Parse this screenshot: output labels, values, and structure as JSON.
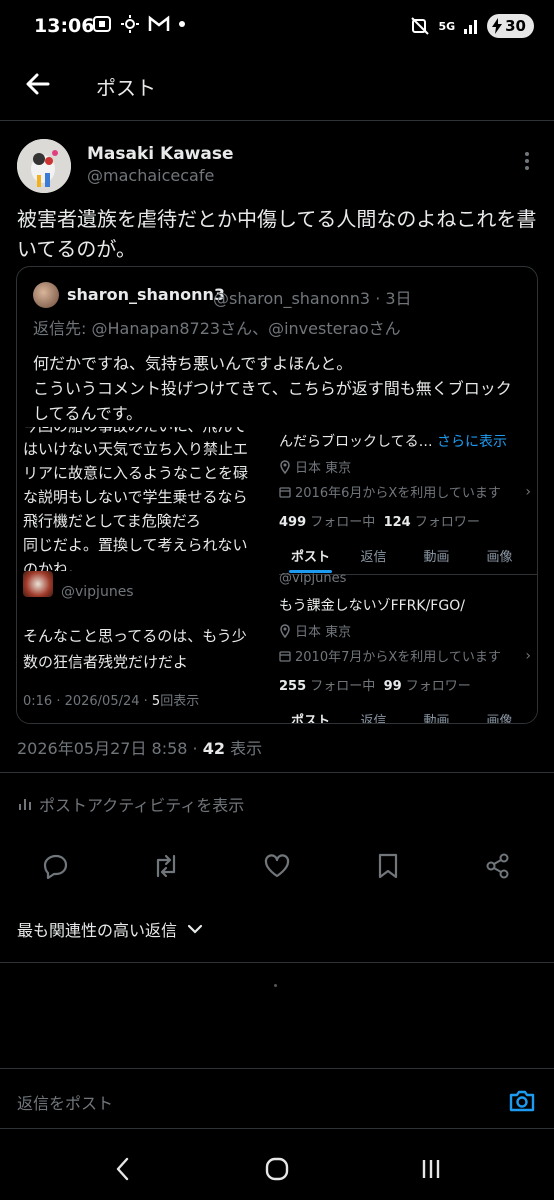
{
  "status_bar": {
    "time": "13:06",
    "network": "5G",
    "battery": "30"
  },
  "header": {
    "title": "ポスト"
  },
  "post": {
    "author_name": "Masaki Kawase",
    "author_handle": "@machaicecafe",
    "text_line1": "被害者遺族を虐待だとか中傷してる人間なのよねこれを書",
    "text_line2": "いてるのが。"
  },
  "quote": {
    "author_name": "sharon_shanonn3",
    "author_handle": "@sharon_shanonn3 · 3日",
    "reply_to": "返信先: @Hanapan8723さん、@investeraoさん",
    "text_line1": "何だかですね、気持ち悪いんですよほんと。",
    "text_line2": "こういうコメント投げつけてきて、こちらが返す間も無くブロック",
    "text_line3": "してるんです。",
    "media": {
      "left_lines": [
        "今回の船の事故みたいに、飛んで",
        "はいけない天気で立ち入り禁止エ",
        "リアに故意に入るようなことを碌",
        "な説明もしないで学生乗せるなら",
        "飛行機だとしてま危険だろ",
        "同じだよ。置換して考えられない",
        "のかね。"
      ],
      "left_handle": "@vipjunes",
      "left_reply_line1": "そんなこと思ってるのは、もう少",
      "left_reply_line2": "数の狂信者残党だけだよ",
      "left_meta": "0:16 · 2026/05/24 · ",
      "left_views": "5",
      "left_views_label": "回表示",
      "right_top": {
        "bio": "んだらブロックしてる…",
        "more": "さらに表示",
        "location": "日本 東京",
        "joined": "2016年6月からXを利用しています",
        "following": "499",
        "following_label": "フォロー中",
        "followers": "124",
        "followers_label": "フォロワー"
      },
      "right_bottom": {
        "handle": "@vipjunes",
        "bio": "もう課金しないゾFFRK/FGO/",
        "location": "日本 東京",
        "joined": "2010年7月からXを利用しています",
        "following": "255",
        "following_label": "フォロー中",
        "followers": "99",
        "followers_label": "フォロワー"
      },
      "tabs": [
        "ポスト",
        "返信",
        "動画",
        "画像"
      ]
    }
  },
  "meta": {
    "timestamp": "2026年05月27日 8:58 · ",
    "views": "42",
    "views_label": " 表示"
  },
  "activity_label": "ポストアクティビティを表示",
  "sort_label": "最も関連性の高い返信",
  "reply_placeholder": "返信をポスト",
  "colors": {
    "accent": "#1d9bf0",
    "secondary_text": "#71767b",
    "background": "#000000"
  }
}
